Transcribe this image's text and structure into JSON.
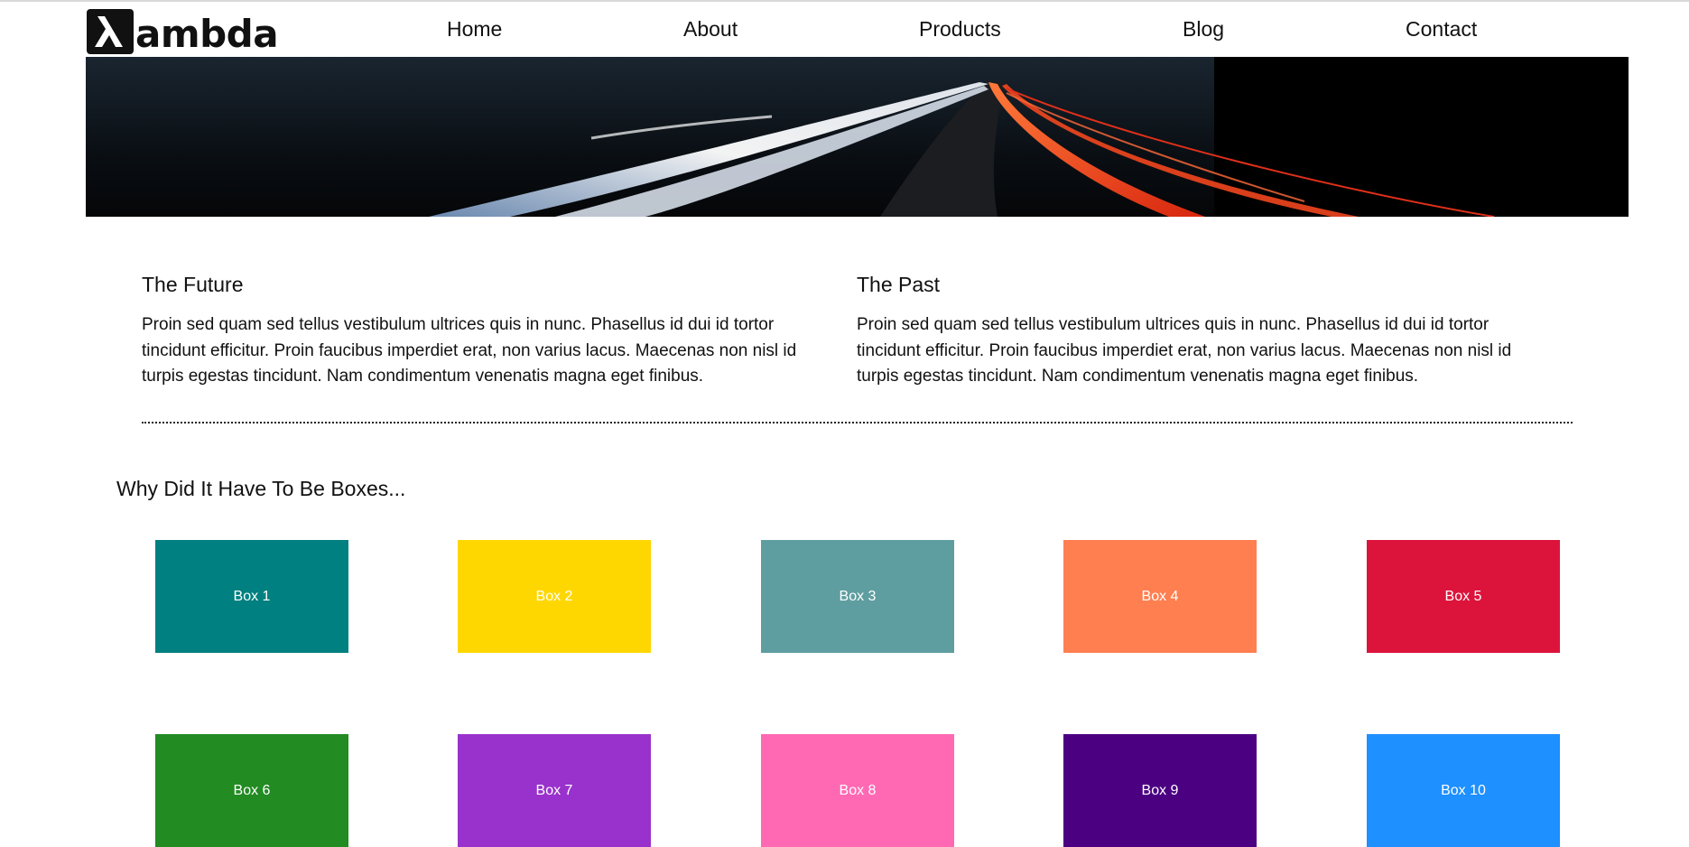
{
  "header": {
    "logo_text": "ambda",
    "nav": [
      "Home",
      "About",
      "Products",
      "Blog",
      "Contact"
    ]
  },
  "articles": [
    {
      "title": "The Future",
      "body": "Proin sed quam sed tellus vestibulum ultrices quis in nunc. Phasellus id dui id tortor tincidunt efficitur. Proin faucibus imperdiet erat, non varius lacus. Maecenas non nisl id turpis egestas tincidunt. Nam condimentum venenatis magna eget finibus."
    },
    {
      "title": "The Past",
      "body": "Proin sed quam sed tellus vestibulum ultrices quis in nunc. Phasellus id dui id tortor tincidunt efficitur. Proin faucibus imperdiet erat, non varius lacus. Maecenas non nisl id turpis egestas tincidunt. Nam condimentum venenatis magna eget finibus."
    }
  ],
  "boxes_section": {
    "title": "Why Did It Have To Be Boxes...",
    "boxes": [
      {
        "label": "Box 1",
        "color": "#008080"
      },
      {
        "label": "Box 2",
        "color": "#FFD700"
      },
      {
        "label": "Box 3",
        "color": "#5F9EA0"
      },
      {
        "label": "Box 4",
        "color": "#FF7F50"
      },
      {
        "label": "Box 5",
        "color": "#DC143C"
      },
      {
        "label": "Box 6",
        "color": "#228B22"
      },
      {
        "label": "Box 7",
        "color": "#9932CC"
      },
      {
        "label": "Box 8",
        "color": "#FF69B4"
      },
      {
        "label": "Box 9",
        "color": "#4B0082"
      },
      {
        "label": "Box 10",
        "color": "#1E90FF"
      }
    ]
  }
}
